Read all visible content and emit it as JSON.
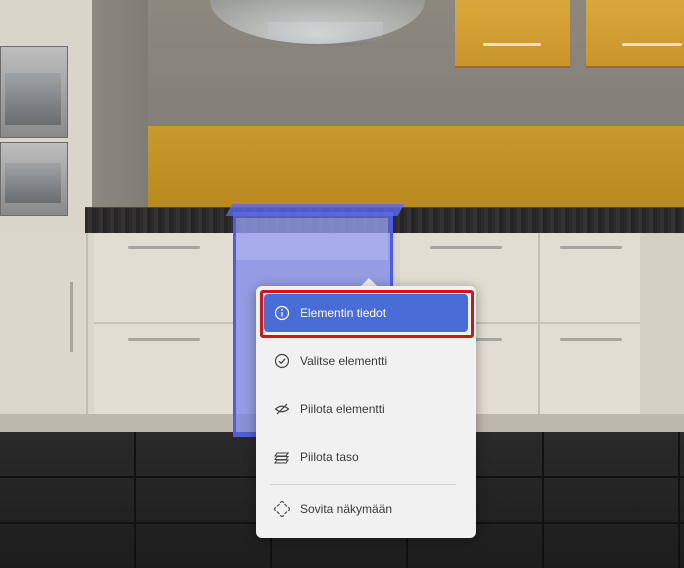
{
  "colors": {
    "accent": "#4a6cd6",
    "selection": "#4b5cf0",
    "highlight_border": "#d01518",
    "menu_background": "#f2f1f1"
  },
  "context_menu": {
    "items": [
      {
        "label": "Elementin tiedot",
        "icon": "info-icon",
        "active": true
      },
      {
        "label": "Valitse elementti",
        "icon": "check-circle-icon",
        "active": false
      },
      {
        "label": "Piilota elementti",
        "icon": "eye-off-icon",
        "active": false
      },
      {
        "label": "Piilota taso",
        "icon": "layers-icon",
        "active": false
      },
      {
        "label": "Sovita näkymään",
        "icon": "fit-view-icon",
        "active": false
      }
    ]
  }
}
